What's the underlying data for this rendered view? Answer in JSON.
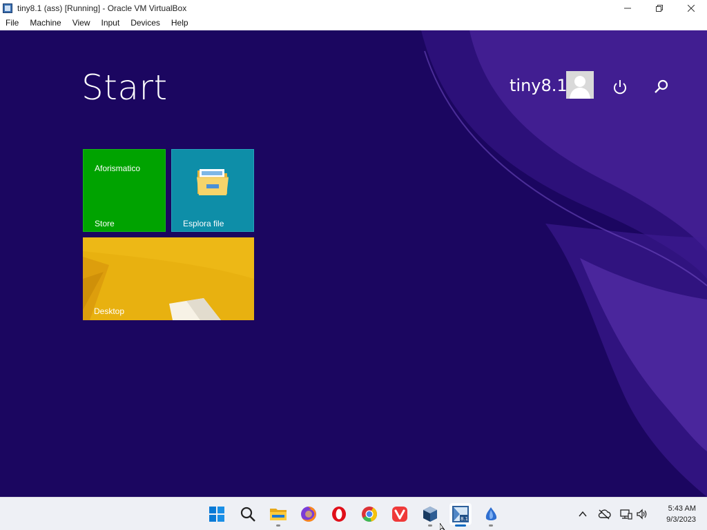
{
  "window": {
    "title": "tiny8.1 (ass) [Running] - Oracle VM VirtualBox",
    "controls": [
      "minimize-icon",
      "restore-icon",
      "close-icon"
    ]
  },
  "menu": {
    "items": [
      "File",
      "Machine",
      "View",
      "Input",
      "Devices",
      "Help"
    ]
  },
  "start_screen": {
    "title": "Start",
    "user": "tiny8.1",
    "tiles": [
      {
        "label": "Store",
        "live_text": "Aforismatico",
        "color": "#00a300"
      },
      {
        "label": "Esplora file",
        "color": "#0e8ea8",
        "icon": "folder-icon"
      },
      {
        "label": "Desktop",
        "color": "#e9b00f"
      }
    ]
  },
  "taskbar": {
    "icons": [
      "windows-start-icon",
      "search-icon",
      "file-explorer-icon",
      "firefox-icon",
      "opera-icon",
      "chrome-icon",
      "vivaldi-icon",
      "virtualbox-icon",
      "vm-tiny81-icon",
      "misc-app-icon"
    ],
    "tray": [
      "chevron-up-icon",
      "cloud-offline-icon",
      "network-icon",
      "volume-icon"
    ],
    "time": "5:43 AM",
    "date": "9/3/2023"
  }
}
